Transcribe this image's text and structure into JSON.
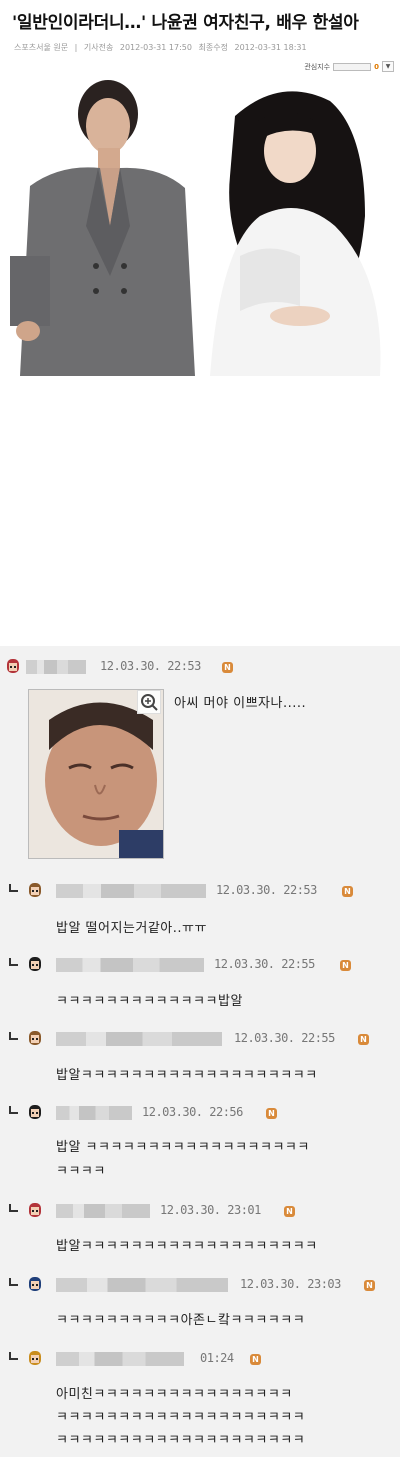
{
  "article": {
    "headline": "'일반인이라더니…' 나윤권 여자친구, 배우 한설아",
    "meta": {
      "source": "스포츠서울 원문",
      "sep": "|",
      "sent_label": "기사전송",
      "sent_time": "2012-03-31 17:50",
      "edited_label": "최종수정",
      "edited_time": "2012-03-31 18:31"
    },
    "interest": {
      "label": "관심지수",
      "count": "0"
    }
  },
  "colors": {
    "badge": "#d98a3a",
    "comment_bg": "#f2f2f2"
  },
  "comments": [
    {
      "time": "12.03.30. 22:53",
      "text": "아씨 머야 이쁘자나.....",
      "is_reply": false,
      "avatar": "girl-red-hair-icon"
    },
    {
      "time": "12.03.30. 22:53",
      "text": "밥알 떨어지는거같아..ㅠㅠ",
      "is_reply": true,
      "avatar": "girl-brown-hair-icon"
    },
    {
      "time": "12.03.30. 22:55",
      "text": "ㅋㅋㅋㅋㅋㅋㅋㅋㅋㅋㅋㅋㅋ밥알",
      "is_reply": true,
      "avatar": "girl-black-hair-icon"
    },
    {
      "time": "12.03.30. 22:55",
      "text": "밥알ㅋㅋㅋㅋㅋㅋㅋㅋㅋㅋㅋㅋㅋㅋㅋㅋㅋㅋㅋ",
      "is_reply": true,
      "avatar": "girl-brown-hair-icon"
    },
    {
      "time": "12.03.30. 22:56",
      "text": "밥알 ㅋㅋㅋㅋㅋㅋㅋㅋㅋㅋㅋㅋㅋㅋㅋㅋㅋㅋ",
      "text2": "ㅋㅋㅋㅋ",
      "is_reply": true,
      "avatar": "girl-black-hair-icon"
    },
    {
      "time": "12.03.30. 23:01",
      "text": "밥알ㅋㅋㅋㅋㅋㅋㅋㅋㅋㅋㅋㅋㅋㅋㅋㅋㅋㅋㅋ",
      "is_reply": true,
      "avatar": "girl-red-hair-icon"
    },
    {
      "time": "12.03.30. 23:03",
      "text": "ㅋㅋㅋㅋㅋㅋㅋㅋㅋㅋ아존ㄴ캌ㅋㅋㅋㅋㅋㅋ",
      "is_reply": true,
      "avatar": "boy-blue-hair-icon"
    },
    {
      "time": "01:24",
      "text": "아미친ㅋㅋㅋㅋㅋㅋㅋㅋㅋㅋㅋㅋㅋㅋㅋㅋ",
      "text2": "ㅋㅋㅋㅋㅋㅋㅋㅋㅋㅋㅋㅋㅋㅋㅋㅋㅋㅋㅋㅋ",
      "text3": "ㅋㅋㅋㅋㅋㅋㅋㅋㅋㅋㅋㅋㅋㅋㅋㅋㅋㅋㅋㅋ",
      "is_reply": true,
      "avatar": "girl-yellow-hair-icon"
    }
  ]
}
